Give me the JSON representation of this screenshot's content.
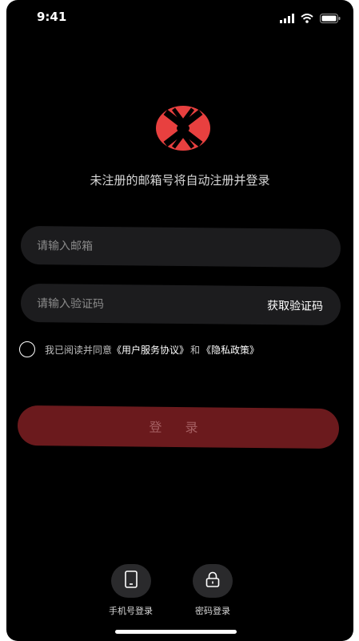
{
  "status_bar": {
    "time": "9:41"
  },
  "subtitle": "未注册的邮箱号将自动注册并登录",
  "email_input": {
    "placeholder": "请输入邮箱"
  },
  "code_input": {
    "placeholder": "请输入验证码"
  },
  "get_code_label": "获取验证码",
  "agreement": {
    "prefix": "我已阅读并同意",
    "user_agreement": "《用户服务协议》",
    "and": "和",
    "privacy_policy": "《隐私政策》"
  },
  "login_label": "登 录",
  "alt_login": {
    "phone_label": "手机号登录",
    "password_label": "密码登录"
  },
  "colors": {
    "background": "#000000",
    "field_bg": "#1c1c1e",
    "brand_red": "#e8403f",
    "login_button": "#6b1a1d"
  },
  "icons": [
    "signal-icon",
    "wifi-icon",
    "battery-icon",
    "app-logo-icon",
    "phone-icon",
    "lock-icon"
  ]
}
